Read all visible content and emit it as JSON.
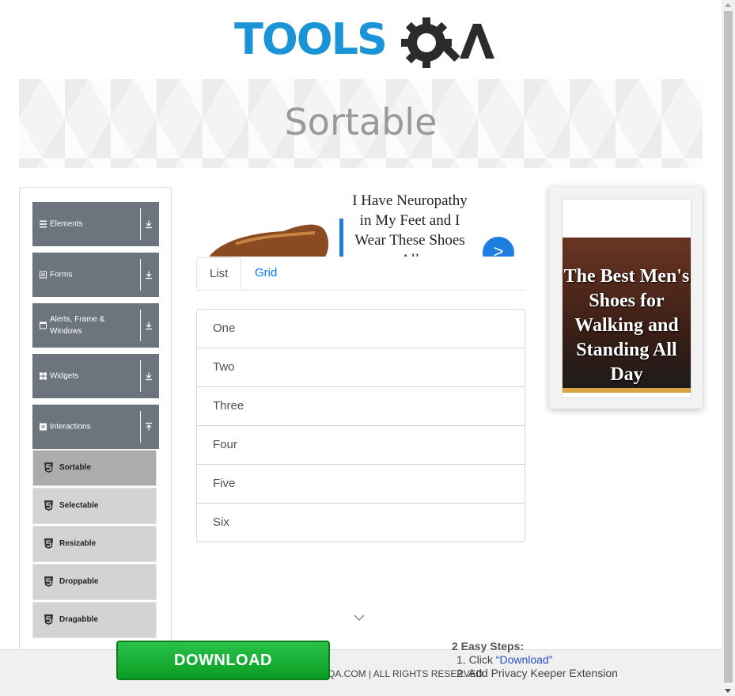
{
  "logo": {
    "text_left": "TOOLS",
    "text_right": "QA"
  },
  "banner": {
    "title": "Sortable"
  },
  "sidebar": {
    "groups": [
      {
        "label": "Elements",
        "icon": "list-icon",
        "arrow": "download-arrow-icon"
      },
      {
        "label": "Forms",
        "icon": "form-icon",
        "arrow": "download-arrow-icon"
      },
      {
        "label": "Alerts, Frame & Windows",
        "icon": "window-icon",
        "arrow": "download-arrow-icon"
      },
      {
        "label": "Widgets",
        "icon": "grid-icon",
        "arrow": "download-arrow-icon"
      },
      {
        "label": "Interactions",
        "icon": "interactions-icon",
        "arrow": "upload-arrow-icon"
      }
    ],
    "items": [
      {
        "label": "Sortable",
        "active": true
      },
      {
        "label": "Selectable",
        "active": false
      },
      {
        "label": "Resizable",
        "active": false
      },
      {
        "label": "Droppable",
        "active": false
      },
      {
        "label": "Dragabble",
        "active": false
      }
    ]
  },
  "ad_middle": {
    "text": "I Have Neuropathy in My Feet and I Wear These Shoes All",
    "button": ">"
  },
  "tabs": [
    {
      "label": "List",
      "active": true
    },
    {
      "label": "Grid",
      "active": false
    }
  ],
  "list": [
    "One",
    "Two",
    "Three",
    "Four",
    "Five",
    "Six"
  ],
  "ad_right": {
    "headline": "The Best Men's Shoes for Walking and Standing All Day"
  },
  "footer": {
    "copyright": "QA.COM | ALL RIGHTS RESERVED.",
    "download_button": "DOWNLOAD",
    "steps_title": "2 Easy Steps:",
    "step1_prefix": "1. Click ",
    "step1_link": "“Download”",
    "step2": "2. Add Privacy Keeper Extension"
  },
  "colors": {
    "accent": "#007bff",
    "group_bg": "#6c757d",
    "item_bg": "#d3d3d3",
    "item_active_bg": "#acacac",
    "download_green": "#1aae35"
  }
}
